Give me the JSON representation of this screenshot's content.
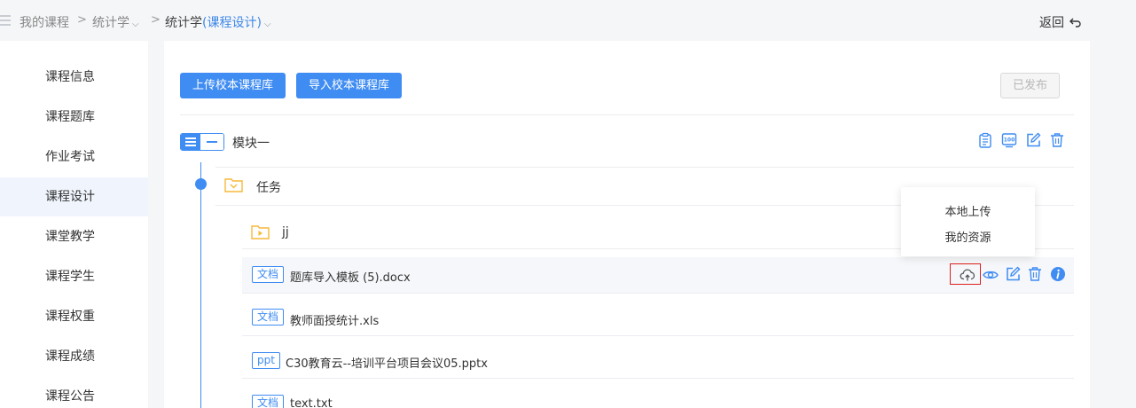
{
  "breadcrumb": {
    "root": "我的课程",
    "sep": ">",
    "course": "统计学",
    "current_prefix": "统计学",
    "current_highlight": "(课程设计)"
  },
  "header": {
    "back_label": "返回"
  },
  "sidebar": {
    "items": [
      {
        "label": "课程信息"
      },
      {
        "label": "课程题库"
      },
      {
        "label": "作业考试"
      },
      {
        "label": "课程设计",
        "active": true
      },
      {
        "label": "课堂教学"
      },
      {
        "label": "课程学生"
      },
      {
        "label": "课程权重"
      },
      {
        "label": "课程成绩"
      },
      {
        "label": "课程公告"
      }
    ]
  },
  "toolbar": {
    "upload_label": "上传校本课程库",
    "import_label": "导入校本课程库",
    "published_label": "已发布"
  },
  "module": {
    "title": "模块一"
  },
  "task": {
    "title": "任务"
  },
  "folder": {
    "name": "jj"
  },
  "files": [
    {
      "type": "文档",
      "name": "题库导入模板 (5).docx"
    },
    {
      "type": "文档",
      "name": "教师面授统计.xls"
    },
    {
      "type": "ppt",
      "name": "C30教育云--培训平台项目会议05.pptx"
    },
    {
      "type": "文档",
      "name": "text.txt"
    }
  ],
  "popover": {
    "items": [
      "本地上传",
      "我的资源"
    ]
  },
  "colors": {
    "accent": "#3f8cf2",
    "folder": "#f6b93b",
    "highlight_border": "#e02020"
  },
  "icons": [
    "menu-icon",
    "chevron-down-icon",
    "back-arrow-icon",
    "clipboard-icon",
    "score-icon",
    "edit-icon",
    "trash-icon",
    "folder-icon",
    "cloud-upload-icon",
    "eye-icon",
    "info-icon"
  ]
}
